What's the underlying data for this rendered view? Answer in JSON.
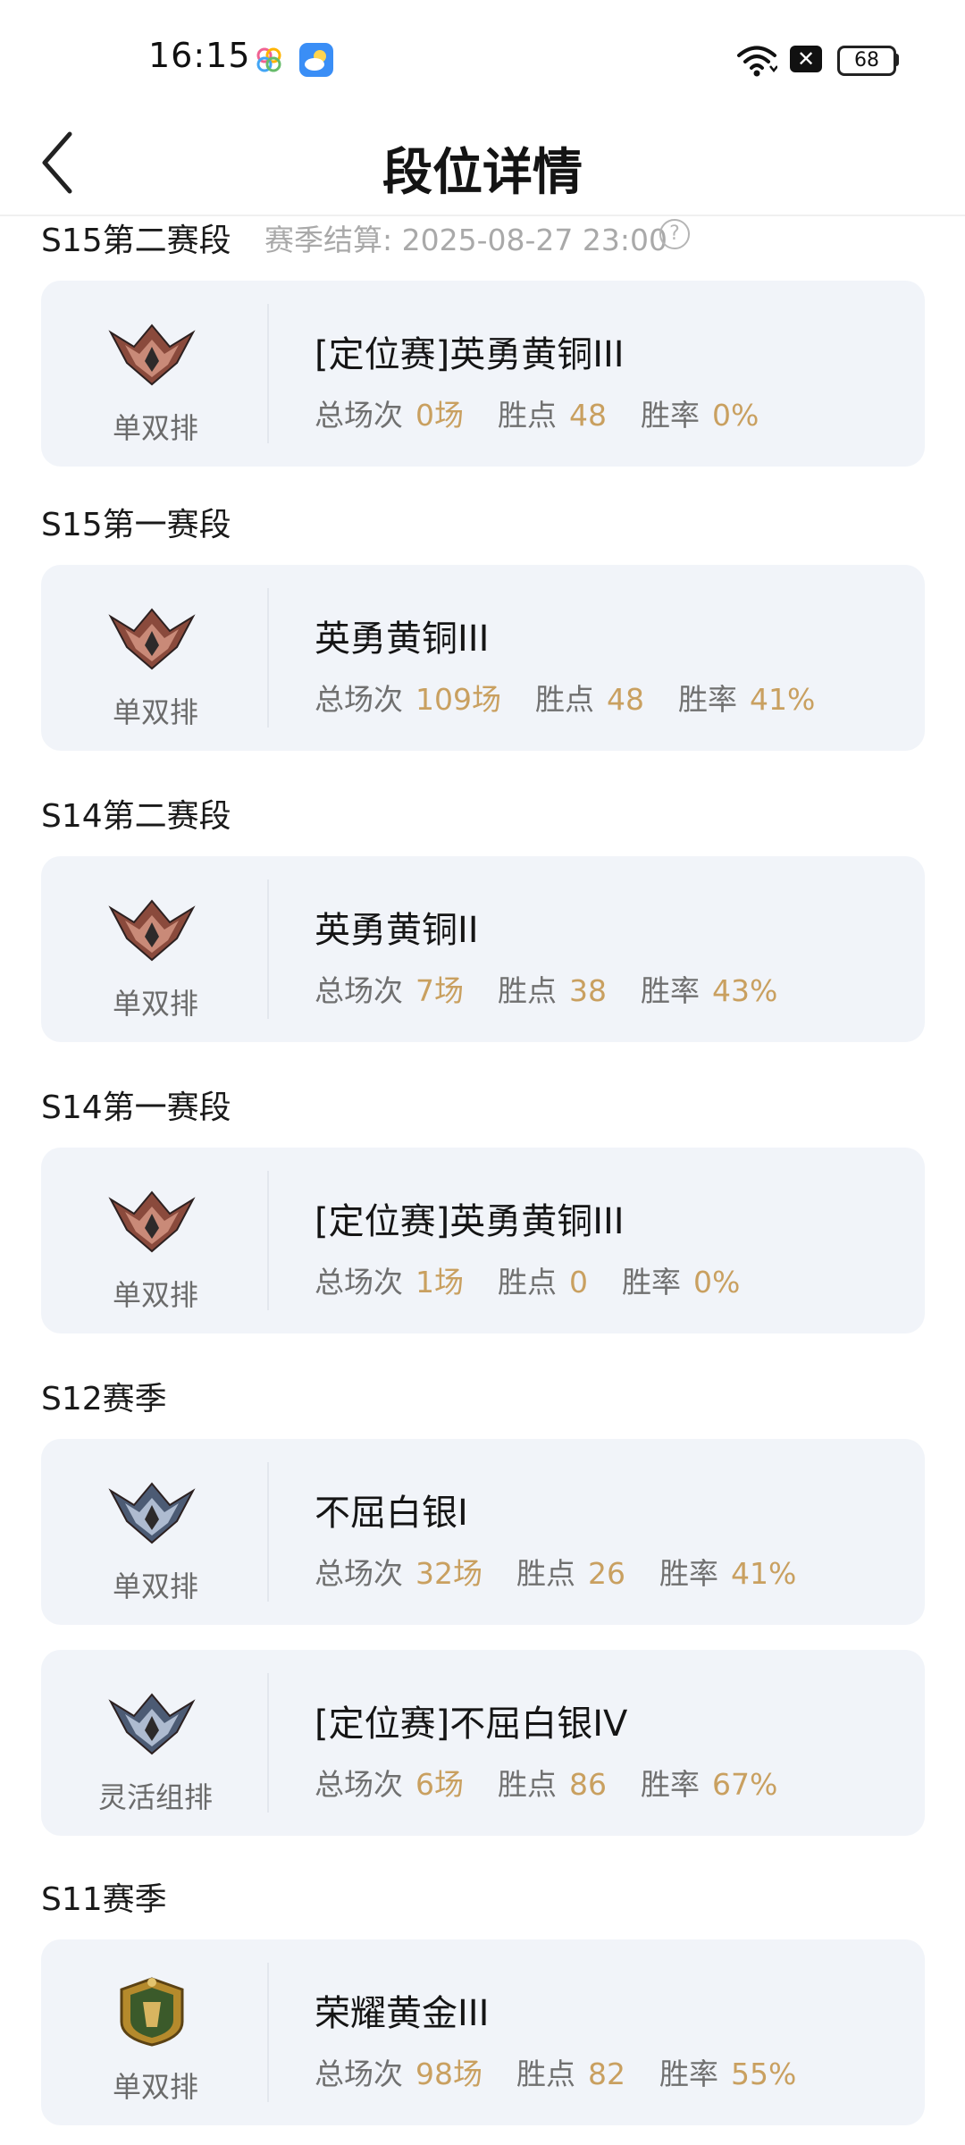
{
  "status": {
    "time": "16:15",
    "battery": "68",
    "x_badge": "✕"
  },
  "header": {
    "title": "段位详情"
  },
  "labels": {
    "games": "总场次",
    "points": "胜点",
    "winrate": "胜率"
  },
  "sections": [
    {
      "season": "S15第二赛段",
      "settlement": "赛季结算: 2025-08-27 23:00",
      "help": "?",
      "cards": [
        {
          "queue": "单双排",
          "rank": "[定位赛]英勇黄铜III",
          "games": "0场",
          "points": "48",
          "winrate": "0%",
          "tier": "bronze"
        }
      ]
    },
    {
      "season": "S15第一赛段",
      "cards": [
        {
          "queue": "单双排",
          "rank": "英勇黄铜III",
          "games": "109场",
          "points": "48",
          "winrate": "41%",
          "tier": "bronze"
        }
      ]
    },
    {
      "season": "S14第二赛段",
      "cards": [
        {
          "queue": "单双排",
          "rank": "英勇黄铜II",
          "games": "7场",
          "points": "38",
          "winrate": "43%",
          "tier": "bronze"
        }
      ]
    },
    {
      "season": "S14第一赛段",
      "cards": [
        {
          "queue": "单双排",
          "rank": "[定位赛]英勇黄铜III",
          "games": "1场",
          "points": "0",
          "winrate": "0%",
          "tier": "bronze"
        }
      ]
    },
    {
      "season": "S12赛季",
      "cards": [
        {
          "queue": "单双排",
          "rank": "不屈白银I",
          "games": "32场",
          "points": "26",
          "winrate": "41%",
          "tier": "silver"
        },
        {
          "queue": "灵活组排",
          "rank": "[定位赛]不屈白银IV",
          "games": "6场",
          "points": "86",
          "winrate": "67%",
          "tier": "silver"
        }
      ]
    },
    {
      "season": "S11赛季",
      "cards": [
        {
          "queue": "单双排",
          "rank": "荣耀黄金III",
          "games": "98场",
          "points": "82",
          "winrate": "55%",
          "tier": "gold"
        }
      ]
    }
  ],
  "colors": {
    "card_bg": "#f1f4f9",
    "value": "#c9a060",
    "bronze": "#8a4a3c",
    "silver": "#4c5b74",
    "gold": "#b58a2c"
  }
}
